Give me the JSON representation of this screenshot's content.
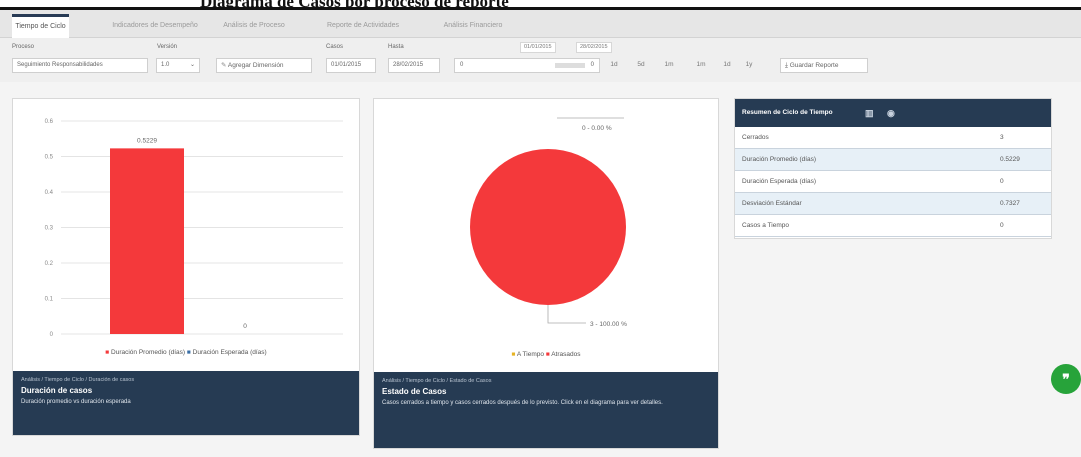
{
  "header": {
    "banner_text": "Diagrama de Casos por proceso de reporte"
  },
  "tabs": [
    {
      "label": "Tiempo de Ciclo"
    },
    {
      "label": "Indicadores de Desempeño"
    },
    {
      "label": "Análisis de Proceso"
    },
    {
      "label": "Reporte de Actividades"
    },
    {
      "label": "Análisis Financiero"
    }
  ],
  "toolbar": {
    "process_label": "Proceso",
    "process_value": "Seguimiento Responsabilidades",
    "version_label": "Versión",
    "version_value": "1.0",
    "add_dimension": "Agregar Dimensión",
    "cases_label": "Casos",
    "date_from": "01/01/2015",
    "to_label": "Hasta",
    "date_to": "28/02/2015",
    "range_start": "01/01/2015",
    "range_end": "28/02/2015",
    "slider_left": "0",
    "slider_right": "0",
    "periods": [
      "1d",
      "5d",
      "1m",
      "1m",
      "1d",
      "1y"
    ],
    "save_report": "Guardar Reporte"
  },
  "chart_left": {
    "crumb": "Análisis / Tiempo de Ciclo / Duración de casos",
    "title": "Duración de casos",
    "description": "Duración promedio vs duración esperada",
    "data_label_1": "0.5229",
    "data_label_2": "0",
    "legend_1": "Duración Promedio (días)",
    "legend_2": "Duración Esperada (días)"
  },
  "chart_right": {
    "crumb": "Análisis / Tiempo de Ciclo / Estado de Casos",
    "title": "Estado de Casos",
    "description": "Casos cerrados a tiempo y casos cerrados después de lo previsto. Click en el diagrama para ver detalles.",
    "label_top": "0 - 0.00 %",
    "label_bottom": "3 - 100.00 %",
    "legend_1": "A Tiempo",
    "legend_2": "Atrasados"
  },
  "chart_data": [
    {
      "type": "bar",
      "categories": [
        "Duración Promedio (días)",
        "Duración Esperada (días)"
      ],
      "values": [
        0.5229,
        0
      ],
      "ylim": [
        0,
        0.6
      ],
      "yticks": [
        "0.6",
        "0.5",
        "0.4",
        "0.3",
        "0.2",
        "0.1",
        "0"
      ],
      "grid": true,
      "legend": "bottom"
    },
    {
      "type": "pie",
      "categories": [
        "A Tiempo",
        "Atrasados"
      ],
      "values": [
        0,
        3
      ],
      "legend": "bottom"
    }
  ],
  "summary": {
    "title": "Resumen de Ciclo de Tiempo",
    "rows": [
      {
        "label": "Cerrados",
        "value": "3"
      },
      {
        "label": "Duración Promedio (días)",
        "value": "0.5229"
      },
      {
        "label": "Duración Esperada (días)",
        "value": "0"
      },
      {
        "label": "Desviación Estándar",
        "value": "0.7327"
      },
      {
        "label": "Casos a Tiempo",
        "value": "0"
      }
    ]
  },
  "colors": {
    "accent": "#263b53",
    "bar": "#f4393b",
    "ontime": "#e6b325",
    "fab": "#27a33a"
  }
}
